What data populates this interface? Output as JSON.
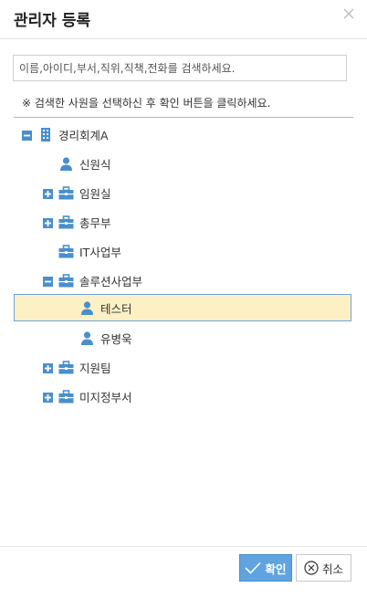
{
  "dialog": {
    "title": "관리자 등록"
  },
  "search": {
    "placeholder": "이름,아이디,부서,직위,직책,전화를 검색하세요."
  },
  "notice": "※ 검색한 사원을 선택하신 후 확인 버튼을 클릭하세요.",
  "tree": {
    "root": "경리회계A",
    "n1": "신원식",
    "n2": "임원실",
    "n3": "총무부",
    "n4": "IT사업부",
    "n5": "솔루션사업부",
    "n6": "테스터",
    "n7": "유병욱",
    "n8": "지원팀",
    "n9": "미지정부서"
  },
  "buttons": {
    "ok": "확인",
    "cancel": "취소"
  },
  "colors": {
    "accent": "#5fa3e0",
    "icon": "#4a8fcc",
    "selected": "#fdf0c4"
  }
}
